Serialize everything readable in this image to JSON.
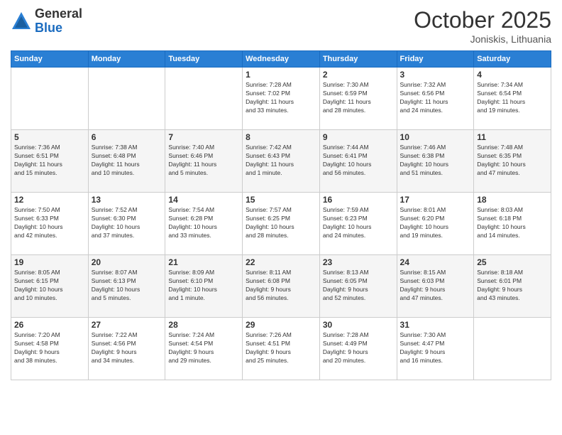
{
  "logo": {
    "general": "General",
    "blue": "Blue"
  },
  "title": "October 2025",
  "location": "Joniskis, Lithuania",
  "weekdays": [
    "Sunday",
    "Monday",
    "Tuesday",
    "Wednesday",
    "Thursday",
    "Friday",
    "Saturday"
  ],
  "weeks": [
    [
      {
        "day": "",
        "info": ""
      },
      {
        "day": "",
        "info": ""
      },
      {
        "day": "",
        "info": ""
      },
      {
        "day": "1",
        "info": "Sunrise: 7:28 AM\nSunset: 7:02 PM\nDaylight: 11 hours\nand 33 minutes."
      },
      {
        "day": "2",
        "info": "Sunrise: 7:30 AM\nSunset: 6:59 PM\nDaylight: 11 hours\nand 28 minutes."
      },
      {
        "day": "3",
        "info": "Sunrise: 7:32 AM\nSunset: 6:56 PM\nDaylight: 11 hours\nand 24 minutes."
      },
      {
        "day": "4",
        "info": "Sunrise: 7:34 AM\nSunset: 6:54 PM\nDaylight: 11 hours\nand 19 minutes."
      }
    ],
    [
      {
        "day": "5",
        "info": "Sunrise: 7:36 AM\nSunset: 6:51 PM\nDaylight: 11 hours\nand 15 minutes."
      },
      {
        "day": "6",
        "info": "Sunrise: 7:38 AM\nSunset: 6:48 PM\nDaylight: 11 hours\nand 10 minutes."
      },
      {
        "day": "7",
        "info": "Sunrise: 7:40 AM\nSunset: 6:46 PM\nDaylight: 11 hours\nand 5 minutes."
      },
      {
        "day": "8",
        "info": "Sunrise: 7:42 AM\nSunset: 6:43 PM\nDaylight: 11 hours\nand 1 minute."
      },
      {
        "day": "9",
        "info": "Sunrise: 7:44 AM\nSunset: 6:41 PM\nDaylight: 10 hours\nand 56 minutes."
      },
      {
        "day": "10",
        "info": "Sunrise: 7:46 AM\nSunset: 6:38 PM\nDaylight: 10 hours\nand 51 minutes."
      },
      {
        "day": "11",
        "info": "Sunrise: 7:48 AM\nSunset: 6:35 PM\nDaylight: 10 hours\nand 47 minutes."
      }
    ],
    [
      {
        "day": "12",
        "info": "Sunrise: 7:50 AM\nSunset: 6:33 PM\nDaylight: 10 hours\nand 42 minutes."
      },
      {
        "day": "13",
        "info": "Sunrise: 7:52 AM\nSunset: 6:30 PM\nDaylight: 10 hours\nand 37 minutes."
      },
      {
        "day": "14",
        "info": "Sunrise: 7:54 AM\nSunset: 6:28 PM\nDaylight: 10 hours\nand 33 minutes."
      },
      {
        "day": "15",
        "info": "Sunrise: 7:57 AM\nSunset: 6:25 PM\nDaylight: 10 hours\nand 28 minutes."
      },
      {
        "day": "16",
        "info": "Sunrise: 7:59 AM\nSunset: 6:23 PM\nDaylight: 10 hours\nand 24 minutes."
      },
      {
        "day": "17",
        "info": "Sunrise: 8:01 AM\nSunset: 6:20 PM\nDaylight: 10 hours\nand 19 minutes."
      },
      {
        "day": "18",
        "info": "Sunrise: 8:03 AM\nSunset: 6:18 PM\nDaylight: 10 hours\nand 14 minutes."
      }
    ],
    [
      {
        "day": "19",
        "info": "Sunrise: 8:05 AM\nSunset: 6:15 PM\nDaylight: 10 hours\nand 10 minutes."
      },
      {
        "day": "20",
        "info": "Sunrise: 8:07 AM\nSunset: 6:13 PM\nDaylight: 10 hours\nand 5 minutes."
      },
      {
        "day": "21",
        "info": "Sunrise: 8:09 AM\nSunset: 6:10 PM\nDaylight: 10 hours\nand 1 minute."
      },
      {
        "day": "22",
        "info": "Sunrise: 8:11 AM\nSunset: 6:08 PM\nDaylight: 9 hours\nand 56 minutes."
      },
      {
        "day": "23",
        "info": "Sunrise: 8:13 AM\nSunset: 6:05 PM\nDaylight: 9 hours\nand 52 minutes."
      },
      {
        "day": "24",
        "info": "Sunrise: 8:15 AM\nSunset: 6:03 PM\nDaylight: 9 hours\nand 47 minutes."
      },
      {
        "day": "25",
        "info": "Sunrise: 8:18 AM\nSunset: 6:01 PM\nDaylight: 9 hours\nand 43 minutes."
      }
    ],
    [
      {
        "day": "26",
        "info": "Sunrise: 7:20 AM\nSunset: 4:58 PM\nDaylight: 9 hours\nand 38 minutes."
      },
      {
        "day": "27",
        "info": "Sunrise: 7:22 AM\nSunset: 4:56 PM\nDaylight: 9 hours\nand 34 minutes."
      },
      {
        "day": "28",
        "info": "Sunrise: 7:24 AM\nSunset: 4:54 PM\nDaylight: 9 hours\nand 29 minutes."
      },
      {
        "day": "29",
        "info": "Sunrise: 7:26 AM\nSunset: 4:51 PM\nDaylight: 9 hours\nand 25 minutes."
      },
      {
        "day": "30",
        "info": "Sunrise: 7:28 AM\nSunset: 4:49 PM\nDaylight: 9 hours\nand 20 minutes."
      },
      {
        "day": "31",
        "info": "Sunrise: 7:30 AM\nSunset: 4:47 PM\nDaylight: 9 hours\nand 16 minutes."
      },
      {
        "day": "",
        "info": ""
      }
    ]
  ]
}
